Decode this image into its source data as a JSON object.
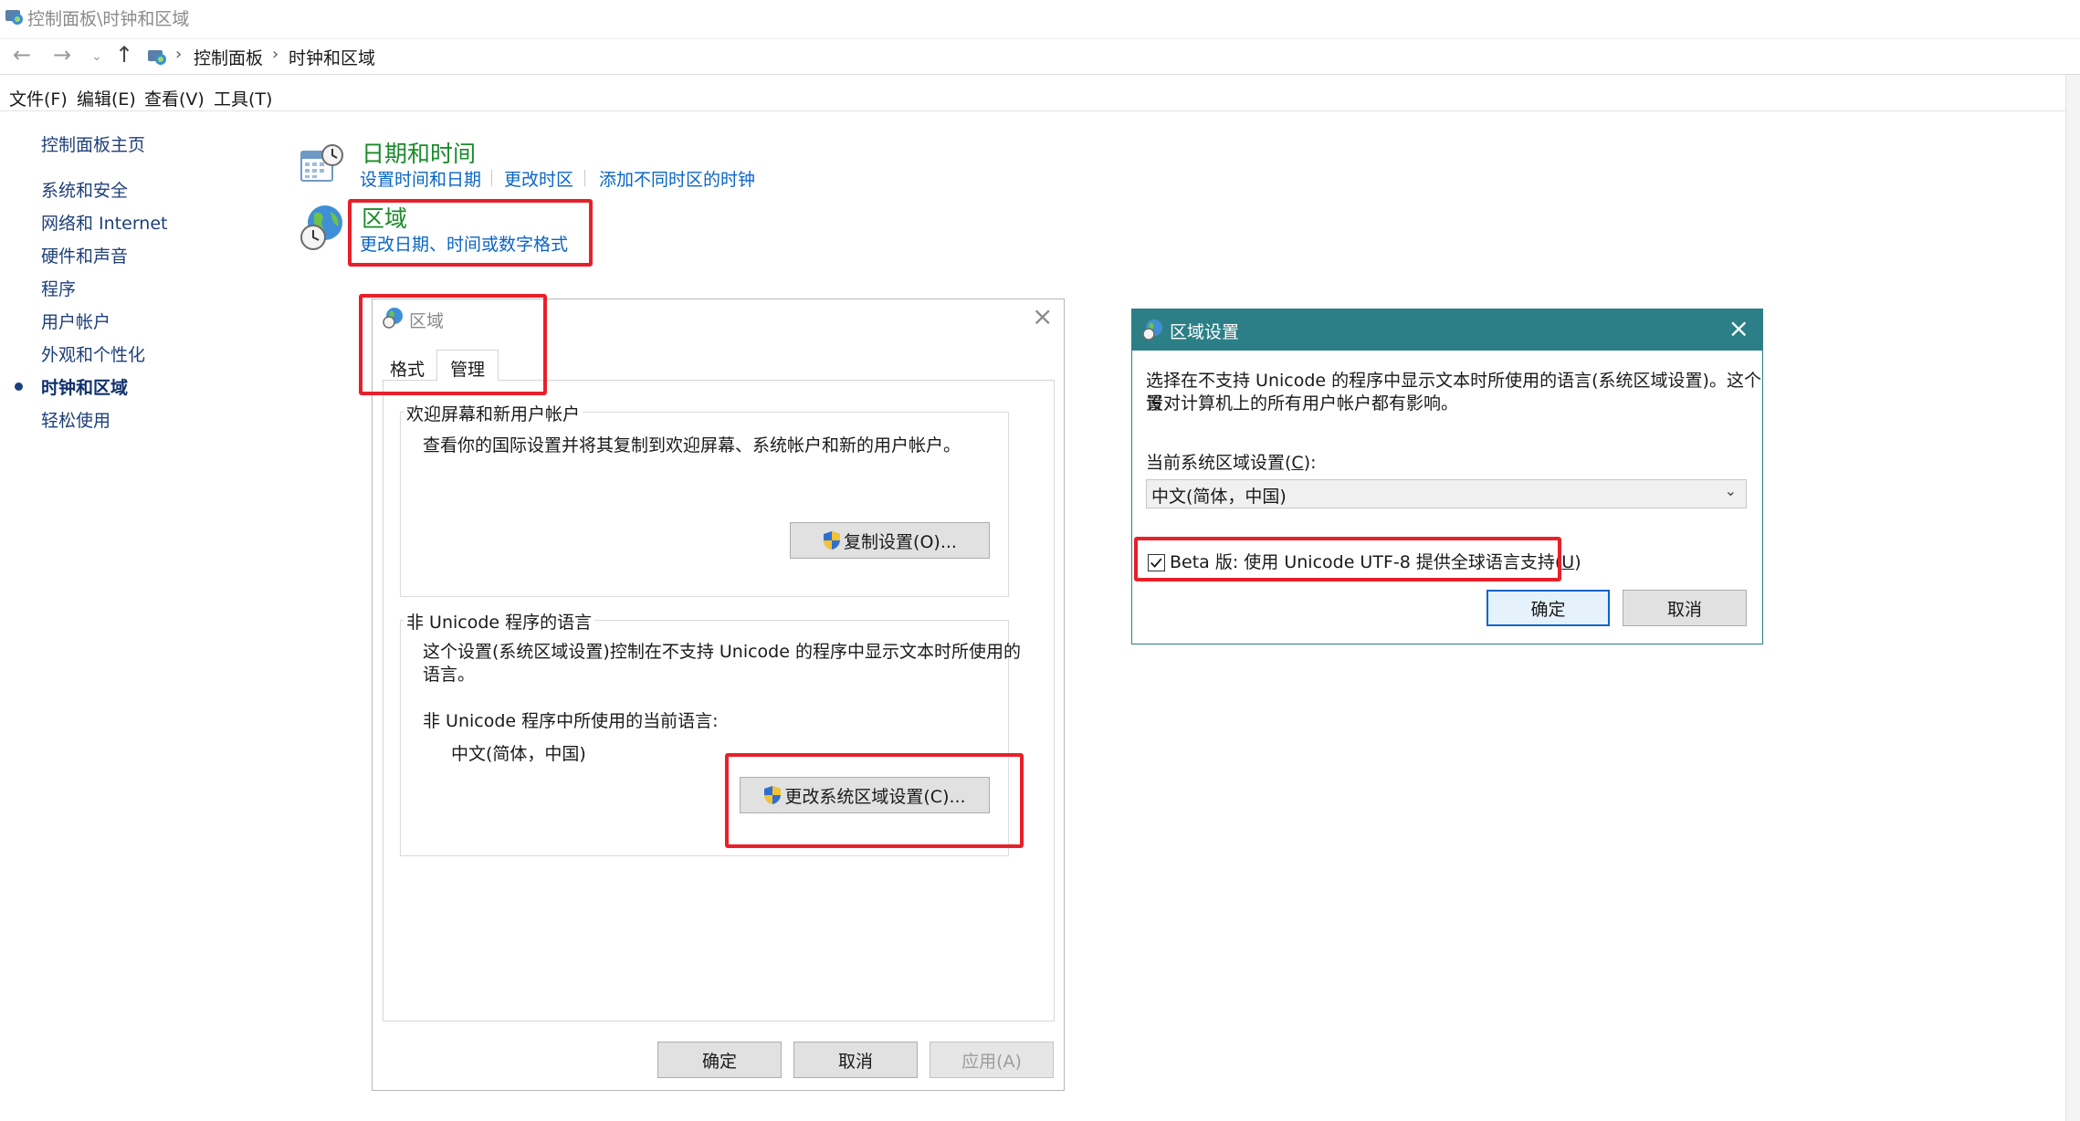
{
  "window": {
    "title": "控制面板\\时钟和区域"
  },
  "address": {
    "breadcrumbs": [
      "控制面板",
      "时钟和区域"
    ],
    "icons": {
      "back": "back-arrow-icon",
      "forward": "forward-arrow-icon",
      "recent": "chevron-down-icon",
      "up": "up-arrow-icon"
    }
  },
  "menu": {
    "items": [
      "文件(F)",
      "编辑(E)",
      "查看(V)",
      "工具(T)"
    ]
  },
  "sidebar": {
    "home": "控制面板主页",
    "items": [
      "系统和安全",
      "网络和 Internet",
      "硬件和声音",
      "程序",
      "用户帐户",
      "外观和个性化",
      "时钟和区域",
      "轻松使用"
    ],
    "active_index": 6
  },
  "categories": {
    "datetime": {
      "title": "日期和时间",
      "links": [
        "设置时间和日期",
        "更改时区",
        "添加不同时区的时钟"
      ]
    },
    "region": {
      "title": "区域",
      "links": [
        "更改日期、时间或数字格式"
      ]
    }
  },
  "region_dialog": {
    "title": "区域",
    "tabs": [
      "格式",
      "管理"
    ],
    "active_tab": "管理",
    "welcome_group": {
      "title": "欢迎屏幕和新用户帐户",
      "desc": "查看你的国际设置并将其复制到欢迎屏幕、系统帐户和新的用户帐户。",
      "button": "复制设置(O)..."
    },
    "unicode_group": {
      "title": "非 Unicode 程序的语言",
      "desc_line1": "这个设置(系统区域设置)控制在不支持 Unicode 的程序中显示文本时所使用的",
      "desc_line2": "语言。",
      "current_label": "非 Unicode 程序中所使用的当前语言:",
      "current_value": "中文(简体，中国)",
      "button": "更改系统区域设置(C)..."
    },
    "buttons": {
      "ok": "确定",
      "cancel": "取消",
      "apply": "应用(A)"
    }
  },
  "region_settings_dialog": {
    "title": "区域设置",
    "desc_line1": "选择在不支持 Unicode 的程序中显示文本时所使用的语言(系统区域设置)。这个设",
    "desc_line2": "置对计算机上的所有用户帐户都有影响。",
    "locale_label_pre": "当前系统区域设置(",
    "locale_label_key": "C",
    "locale_label_post": "):",
    "locale_value": "中文(简体，中国)",
    "beta_label_pre": "Beta 版: 使用 Unicode UTF-8 提供全球语言支持(",
    "beta_label_key": "U",
    "beta_label_post": ")",
    "beta_checked": true,
    "buttons": {
      "ok": "确定",
      "cancel": "取消"
    }
  },
  "colors": {
    "link": "#0a64c8",
    "category_title": "#1a8a2a",
    "annotation": "#e8202a",
    "dialog_title": "#2c7f86"
  }
}
